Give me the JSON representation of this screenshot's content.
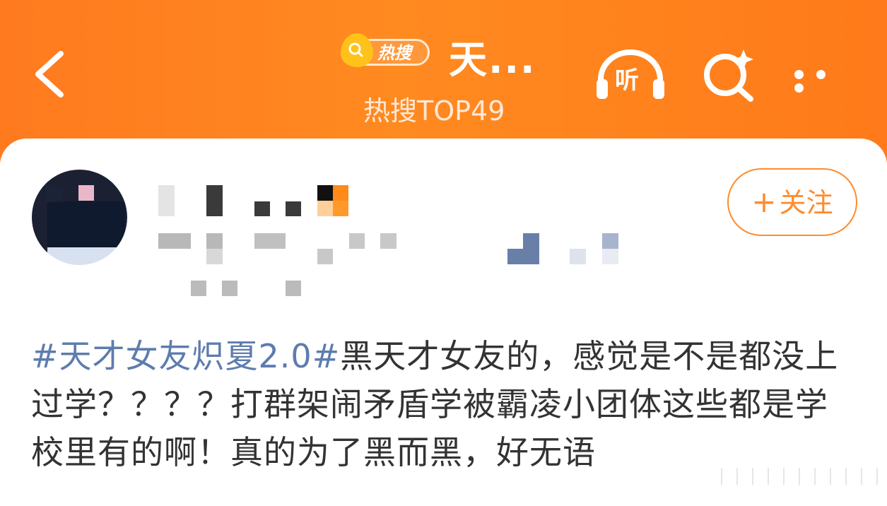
{
  "header": {
    "back_icon": "chevron-left-icon",
    "badge": {
      "text": "热搜",
      "icon": "search-icon"
    },
    "title": "天...",
    "subtitle": "热搜TOP49",
    "listen_label": "听",
    "listen_icon": "headphones-icon",
    "search_icon": "search-sparkle-icon",
    "more_icon": "more-dots-icon",
    "colors": {
      "bg": "#ff7f1e",
      "text": "#ffffff"
    }
  },
  "profile": {
    "follow_label": "关注",
    "follow_icon": "plus-icon",
    "accent": "#ff8b2c"
  },
  "post": {
    "hashtag": "#天才女友炽夏2.0#",
    "body": "黑天才女友的，感觉是不是都没上过学？？？？打群架闹矛盾学被霸凌小团体这些都是学校里有的啊！真的为了黑而黑，好无语",
    "hashtag_color": "#5e7cae"
  }
}
